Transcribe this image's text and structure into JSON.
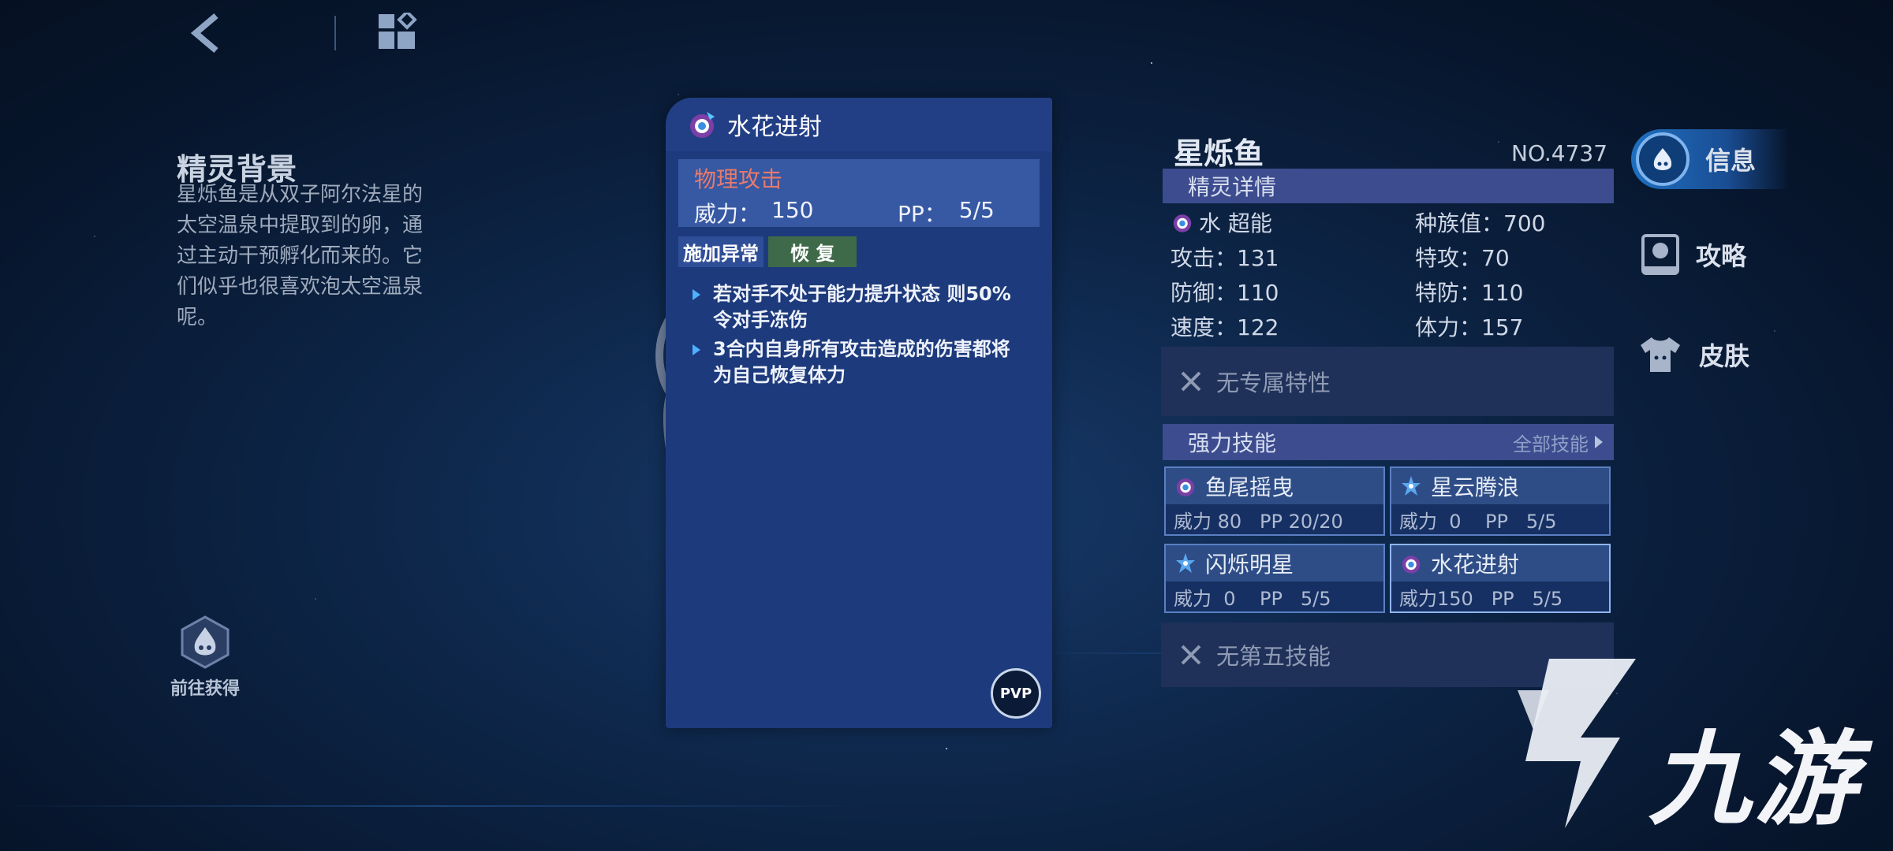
{
  "background": {
    "title": "精灵背景",
    "text": "星烁鱼是从双子阿尔法星的太空温泉中提取到的卵，通过主动干预孵化而来的。它们似乎也很喜欢泡太空温泉呢。",
    "goto_label": "前往获得"
  },
  "skill_detail": {
    "name": "水花进射",
    "category": "物理攻击",
    "power_label": "威力：",
    "power_value": "150",
    "pp_label": "PP：",
    "pp_value": "5/5",
    "tag1": "施加异常",
    "tag2": "恢 复",
    "effects": [
      "若对手不处于能力提升状态 则50%令对手冻伤",
      "3合内自身所有攻击造成的伤害都将为自己恢复体力"
    ],
    "pvp_label": "PVP"
  },
  "pet": {
    "name": "星烁鱼",
    "number": "NO.4737",
    "details_label": "精灵详情",
    "types": "水 超能",
    "stats": [
      [
        "种族值：700"
      ],
      [
        "攻击：131",
        "特攻：70"
      ],
      [
        "防御：110",
        "特防：110"
      ],
      [
        "速度：122",
        "体力：157"
      ]
    ],
    "trait": "无专属特性",
    "skills_label": "强力技能",
    "all_skills_label": "全部技能",
    "skills": [
      {
        "name": "鱼尾摇曳",
        "info": "威力 80   PP 20/20",
        "icon": "water-psychic-icon"
      },
      {
        "name": "星云腾浪",
        "info": "威力  0    PP   5/5",
        "icon": "star-icon"
      },
      {
        "name": "闪烁明星",
        "info": "威力  0    PP   5/5",
        "icon": "star-icon"
      },
      {
        "name": "水花进射",
        "info": "威力150   PP   5/5",
        "icon": "water-psychic-icon"
      }
    ],
    "fifth_skill": "无第五技能"
  },
  "tabs": {
    "info": "信息",
    "guide": "攻略",
    "skin": "皮肤"
  },
  "watermark": "九游",
  "colors": {
    "accent": "#1e6fc0",
    "category": "#e97a6a",
    "card": "#1d3a7c"
  }
}
